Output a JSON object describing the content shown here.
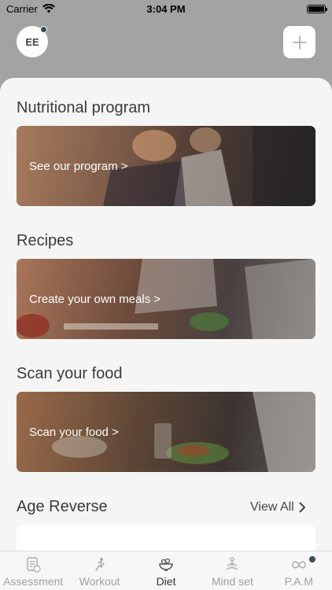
{
  "status_bar": {
    "carrier": "Carrier",
    "time": "3:04 PM"
  },
  "header": {
    "avatar_initials": "EE"
  },
  "sections": {
    "nutrition": {
      "title": "Nutritional program",
      "card_label": "See our program >"
    },
    "recipes": {
      "title": "Recipes",
      "card_label": "Create your own meals >"
    },
    "scan": {
      "title": "Scan your food",
      "card_label": "Scan your food >"
    },
    "age_reverse": {
      "title": "Age Reverse",
      "view_all": "View All"
    }
  },
  "tabs": [
    {
      "label": "Assessment",
      "icon": "assessment-icon",
      "active": false
    },
    {
      "label": "Workout",
      "icon": "workout-icon",
      "active": false
    },
    {
      "label": "Diet",
      "icon": "diet-icon",
      "active": true
    },
    {
      "label": "Mind set",
      "icon": "mindset-icon",
      "active": false
    },
    {
      "label": "P.A.M",
      "icon": "pam-icon",
      "active": false
    }
  ],
  "colors": {
    "background": "#a3a3a3",
    "sheet": "#f5f5f5",
    "tab_active": "#333333",
    "tab_inactive": "#a0a0a0",
    "badge": "#3f4a5a"
  }
}
